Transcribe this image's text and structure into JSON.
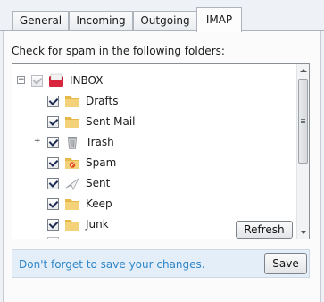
{
  "tabs": [
    {
      "label": "General",
      "active": false
    },
    {
      "label": "Incoming",
      "active": false
    },
    {
      "label": "Outgoing",
      "active": false
    },
    {
      "label": "IMAP",
      "active": true
    }
  ],
  "caption": "Check for spam in the following folders:",
  "folders": [
    {
      "label": "INBOX",
      "checked": true,
      "greyed": true,
      "icon": "inbox-icon",
      "expander": "−"
    },
    {
      "label": "Drafts",
      "checked": true,
      "icon": "folder-icon"
    },
    {
      "label": "Sent Mail",
      "checked": true,
      "icon": "folder-icon"
    },
    {
      "label": "Trash",
      "checked": true,
      "icon": "trash-icon",
      "expander": "+"
    },
    {
      "label": "Spam",
      "checked": true,
      "icon": "spam-folder-icon"
    },
    {
      "label": "Sent",
      "checked": true,
      "icon": "sent-icon"
    },
    {
      "label": "Keep",
      "checked": true,
      "icon": "folder-icon"
    },
    {
      "label": "Junk",
      "checked": true,
      "icon": "folder-icon"
    }
  ],
  "refresh_label": "Refresh",
  "footer": {
    "hint": "Don't forget to save your changes.",
    "save_label": "Save"
  },
  "colors": {
    "hint": "#2f86c9",
    "footer_bg": "#e4eef8"
  }
}
